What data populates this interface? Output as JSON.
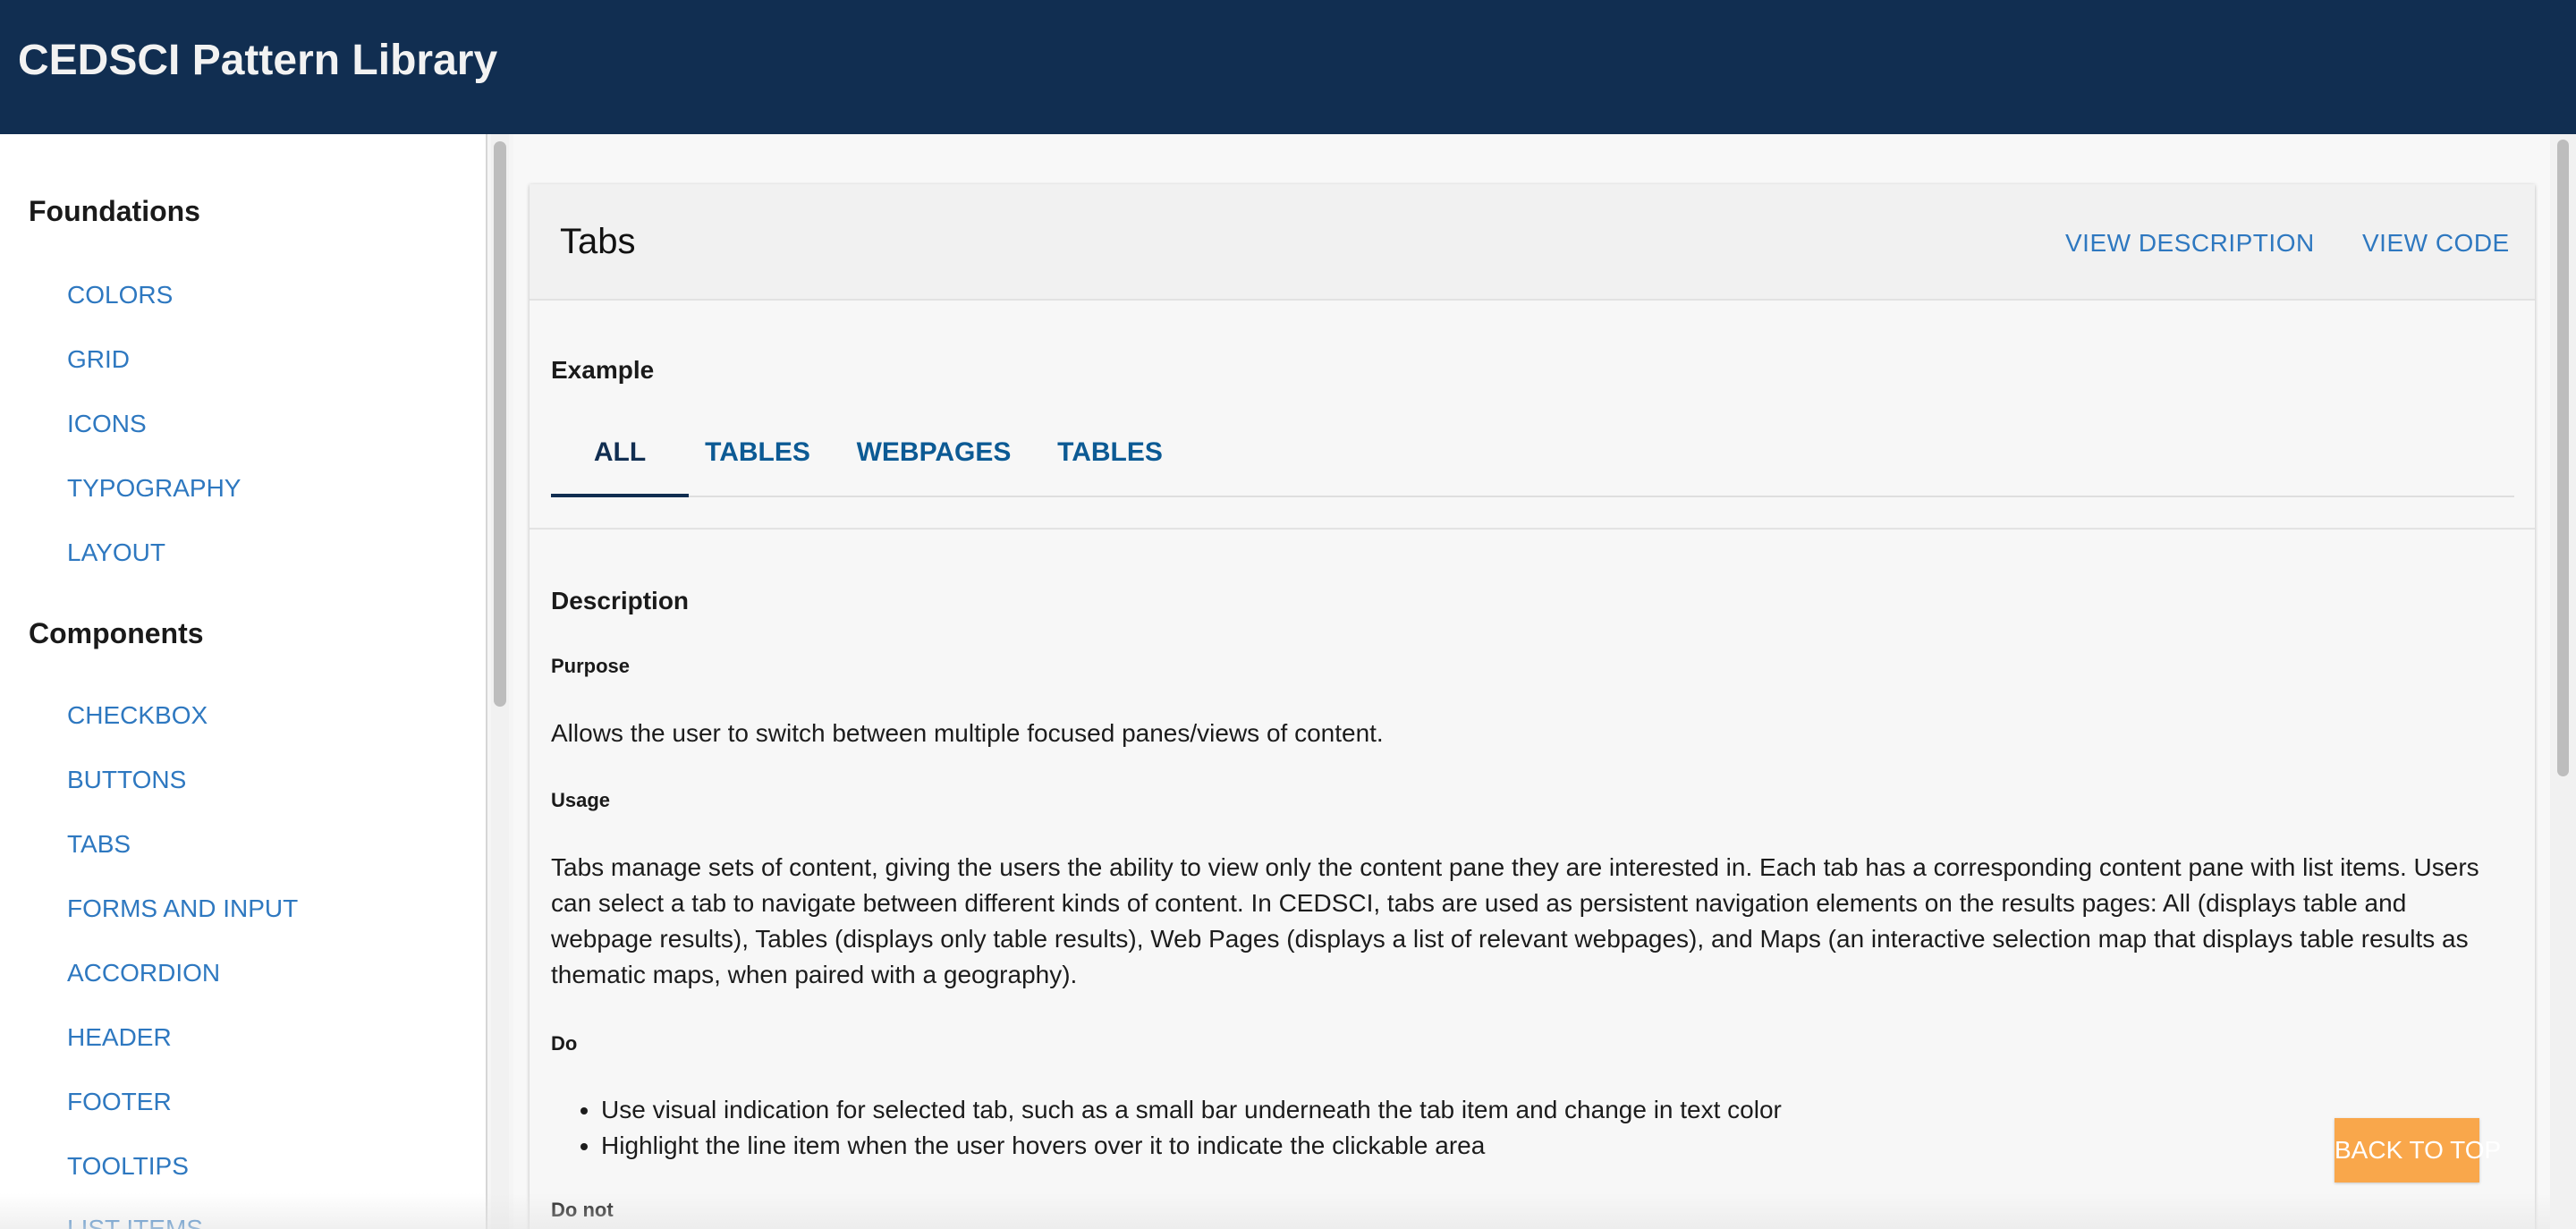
{
  "header": {
    "title": "CEDSCI Pattern Library"
  },
  "sidebar": {
    "foundations_heading": "Foundations",
    "foundations": [
      "COLORS",
      "GRID",
      "ICONS",
      "TYPOGRAPHY",
      "LAYOUT"
    ],
    "components_heading": "Components",
    "components": [
      "CHECKBOX",
      "BUTTONS",
      "TABS",
      "FORMS AND INPUT",
      "ACCORDION",
      "HEADER",
      "FOOTER",
      "TOOLTIPS",
      "LIST ITEMS"
    ]
  },
  "card": {
    "title": "Tabs",
    "view_description": "VIEW DESCRIPTION",
    "view_code": "VIEW CODE",
    "example_heading": "Example",
    "tabs": [
      "ALL",
      "TABLES",
      "WEBPAGES",
      "TABLES"
    ],
    "active_tab": "ALL",
    "description_heading": "Description",
    "purpose_heading": "Purpose",
    "purpose_text": "Allows the user to switch between multiple focused panes/views of content.",
    "usage_heading": "Usage",
    "usage_text": "Tabs manage sets of content, giving the users the ability to view only the content pane they are interested in. Each tab has a corresponding content pane with list items. Users can select a tab to navigate between different kinds of content. In CEDSCI, tabs are used as persistent navigation elements on the results pages: All (displays table and webpage results), Tables (displays only table results), Web Pages (displays a list of relevant webpages), and Maps (an interactive selection map that displays table results as thematic maps, when paired with a geography).",
    "do_heading": "Do",
    "do_items": [
      "Use visual indication for selected tab, such as a small bar underneath the tab item and change in text color",
      "Highlight the line item when the user hovers over it to indicate the clickable area"
    ],
    "donot_heading": "Do not"
  },
  "back_to_top": "BACK TO TOP",
  "colors": {
    "header_bg": "#112e51",
    "link": "#2e78c0",
    "tab": "#0c5a94",
    "back_to_top": "#f9a74b"
  }
}
